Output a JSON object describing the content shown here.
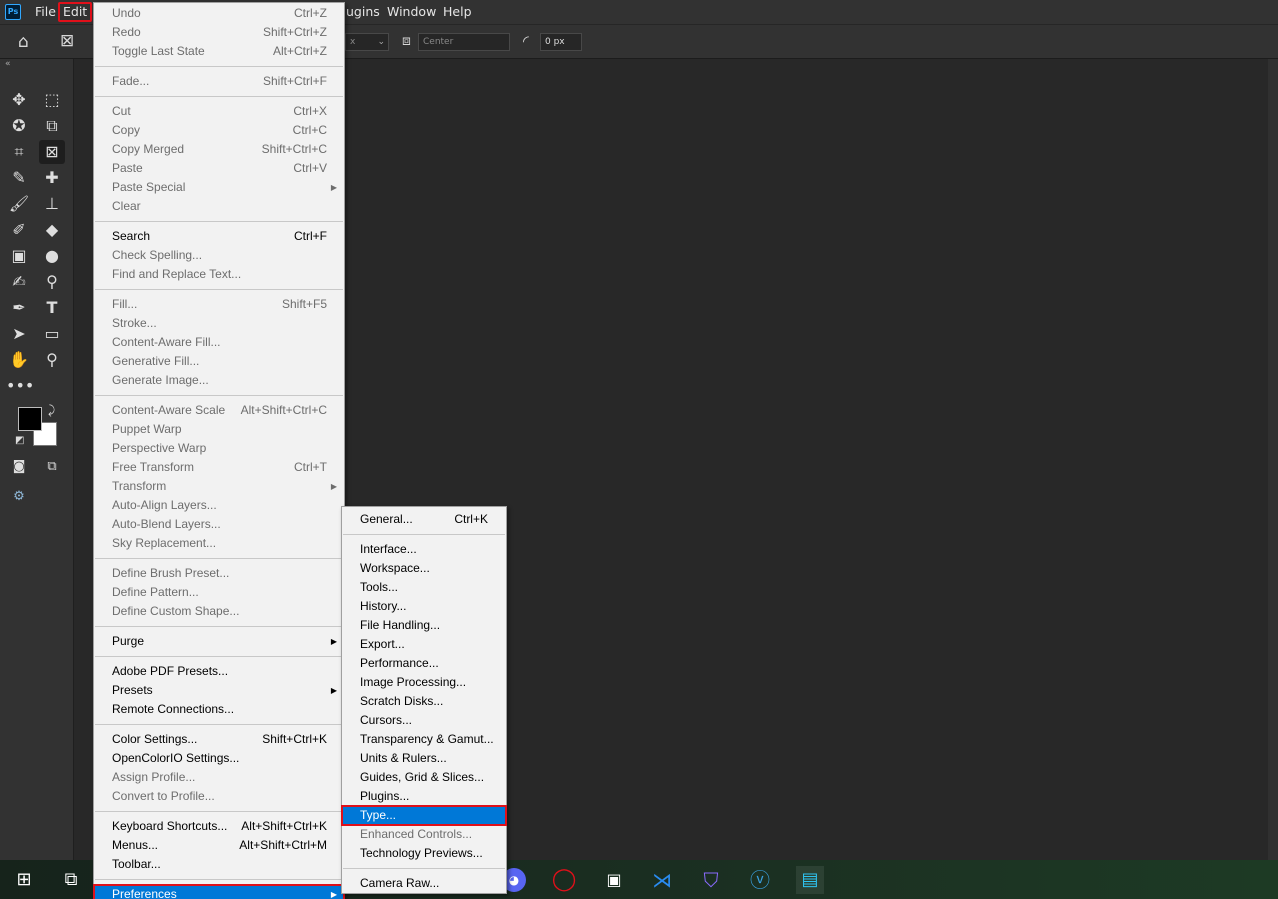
{
  "app": {
    "logo": "Ps"
  },
  "menubar": {
    "items": [
      "File",
      "Edit",
      "ugins",
      "Window",
      "Help"
    ]
  },
  "optionsbar": {
    "field_left": "x",
    "align_label": "Center",
    "radius_value": "0 px"
  },
  "edit_menu": [
    {
      "label": "Undo",
      "shortcut": "Ctrl+Z",
      "disabled": true
    },
    {
      "label": "Redo",
      "shortcut": "Shift+Ctrl+Z",
      "disabled": true
    },
    {
      "label": "Toggle Last State",
      "shortcut": "Alt+Ctrl+Z",
      "disabled": true
    },
    {
      "sep": true
    },
    {
      "label": "Fade...",
      "shortcut": "Shift+Ctrl+F",
      "disabled": true
    },
    {
      "sep": true
    },
    {
      "label": "Cut",
      "shortcut": "Ctrl+X",
      "disabled": true
    },
    {
      "label": "Copy",
      "shortcut": "Ctrl+C",
      "disabled": true
    },
    {
      "label": "Copy Merged",
      "shortcut": "Shift+Ctrl+C",
      "disabled": true
    },
    {
      "label": "Paste",
      "shortcut": "Ctrl+V",
      "disabled": true
    },
    {
      "label": "Paste Special",
      "submenu": true,
      "disabled": true
    },
    {
      "label": "Clear",
      "disabled": true
    },
    {
      "sep": true
    },
    {
      "label": "Search",
      "shortcut": "Ctrl+F",
      "disabled": false
    },
    {
      "label": "Check Spelling...",
      "disabled": true
    },
    {
      "label": "Find and Replace Text...",
      "disabled": true
    },
    {
      "sep": true
    },
    {
      "label": "Fill...",
      "shortcut": "Shift+F5",
      "disabled": true
    },
    {
      "label": "Stroke...",
      "disabled": true
    },
    {
      "label": "Content-Aware Fill...",
      "disabled": true
    },
    {
      "label": "Generative Fill...",
      "disabled": true
    },
    {
      "label": "Generate Image...",
      "disabled": true
    },
    {
      "sep": true
    },
    {
      "label": "Content-Aware Scale",
      "shortcut": "Alt+Shift+Ctrl+C",
      "disabled": true
    },
    {
      "label": "Puppet Warp",
      "disabled": true
    },
    {
      "label": "Perspective Warp",
      "disabled": true
    },
    {
      "label": "Free Transform",
      "shortcut": "Ctrl+T",
      "disabled": true
    },
    {
      "label": "Transform",
      "submenu": true,
      "disabled": true
    },
    {
      "label": "Auto-Align Layers...",
      "disabled": true
    },
    {
      "label": "Auto-Blend Layers...",
      "disabled": true
    },
    {
      "label": "Sky Replacement...",
      "disabled": true
    },
    {
      "sep": true
    },
    {
      "label": "Define Brush Preset...",
      "disabled": true
    },
    {
      "label": "Define Pattern...",
      "disabled": true
    },
    {
      "label": "Define Custom Shape...",
      "disabled": true
    },
    {
      "sep": true
    },
    {
      "label": "Purge",
      "submenu": true,
      "disabled": false
    },
    {
      "sep": true
    },
    {
      "label": "Adobe PDF Presets...",
      "disabled": false
    },
    {
      "label": "Presets",
      "submenu": true,
      "disabled": false
    },
    {
      "label": "Remote Connections...",
      "disabled": false
    },
    {
      "sep": true
    },
    {
      "label": "Color Settings...",
      "shortcut": "Shift+Ctrl+K",
      "disabled": false
    },
    {
      "label": "OpenColorIO Settings...",
      "disabled": false
    },
    {
      "label": "Assign Profile...",
      "disabled": true
    },
    {
      "label": "Convert to Profile...",
      "disabled": true
    },
    {
      "sep": true
    },
    {
      "label": "Keyboard Shortcuts...",
      "shortcut": "Alt+Shift+Ctrl+K",
      "disabled": false
    },
    {
      "label": "Menus...",
      "shortcut": "Alt+Shift+Ctrl+M",
      "disabled": false
    },
    {
      "label": "Toolbar...",
      "disabled": false
    },
    {
      "sep": true
    },
    {
      "label": "Preferences",
      "submenu": true,
      "disabled": false,
      "highlighted": true
    }
  ],
  "preferences_menu": [
    {
      "label": "General...",
      "shortcut": "Ctrl+K",
      "disabled": false
    },
    {
      "sep": true
    },
    {
      "label": "Interface...",
      "disabled": false
    },
    {
      "label": "Workspace...",
      "disabled": false
    },
    {
      "label": "Tools...",
      "disabled": false
    },
    {
      "label": "History...",
      "disabled": false
    },
    {
      "label": "File Handling...",
      "disabled": false
    },
    {
      "label": "Export...",
      "disabled": false
    },
    {
      "label": "Performance...",
      "disabled": false
    },
    {
      "label": "Image Processing...",
      "disabled": false
    },
    {
      "label": "Scratch Disks...",
      "disabled": false
    },
    {
      "label": "Cursors...",
      "disabled": false
    },
    {
      "label": "Transparency & Gamut...",
      "disabled": false
    },
    {
      "label": "Units & Rulers...",
      "disabled": false
    },
    {
      "label": "Guides, Grid & Slices...",
      "disabled": false
    },
    {
      "label": "Plugins...",
      "disabled": false
    },
    {
      "label": "Type...",
      "disabled": false,
      "highlighted": true
    },
    {
      "label": "Enhanced Controls...",
      "disabled": true
    },
    {
      "label": "Technology Previews...",
      "disabled": false
    },
    {
      "sep": true
    },
    {
      "label": "Camera Raw...",
      "disabled": false
    }
  ],
  "colors": {
    "highlight": "#0078d7",
    "annotation_red": "#e0101a",
    "ui_dark": "#323232",
    "canvas": "#282828"
  },
  "taskbar": {
    "icons": [
      "windows-start-icon",
      "task-view-icon",
      "discord-icon",
      "opera-icon",
      "notion-icon",
      "vscode-icon",
      "proton-vpn-icon",
      "vivaldi-icon",
      "app-icon"
    ]
  }
}
